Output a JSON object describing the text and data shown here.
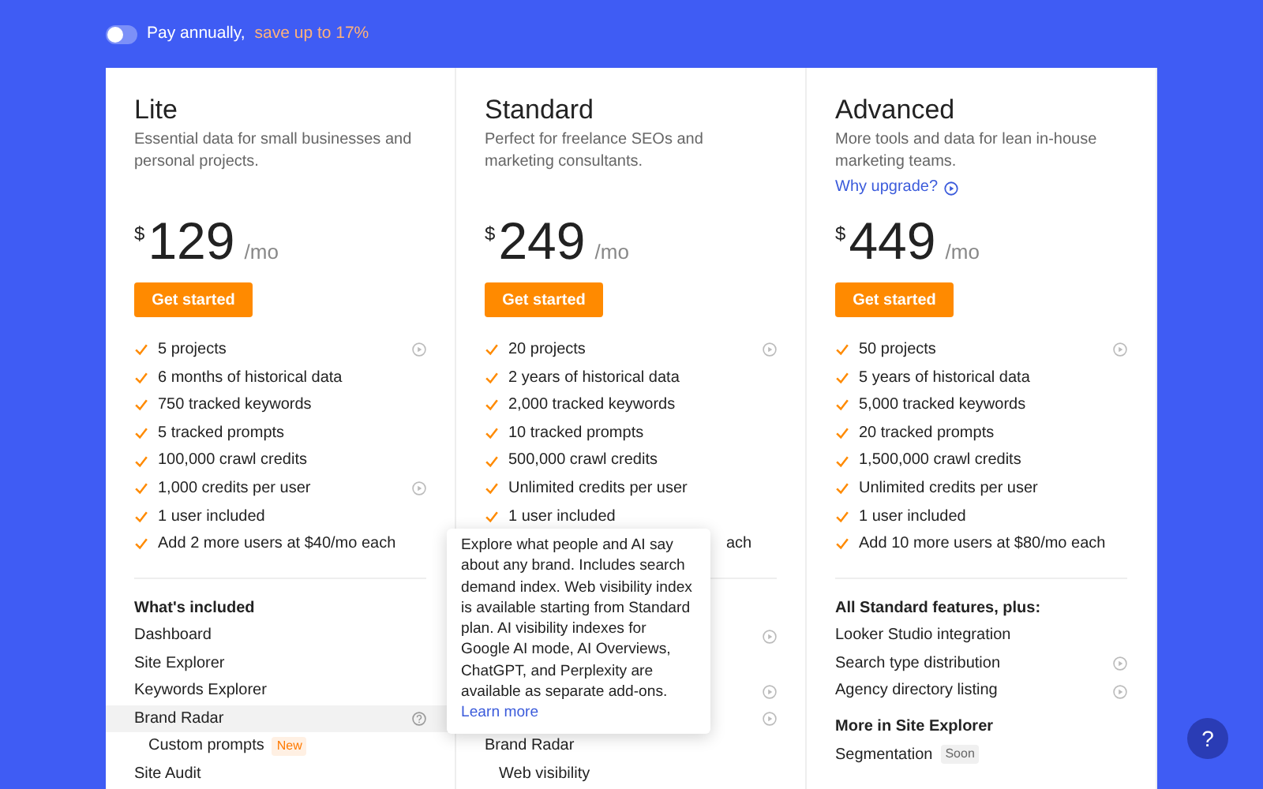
{
  "billing_toggle": {
    "on": false,
    "label": "Pay annually,",
    "highlight": "save up to 17%"
  },
  "plans": [
    {
      "name": "Lite",
      "description": "Essential data for small businesses and personal projects.",
      "currency": "$",
      "price": "129",
      "period": "/mo",
      "button": "Get started",
      "limits": [
        {
          "text": "5 projects",
          "info": true
        },
        {
          "text": "6 months of historical data",
          "info": false
        },
        {
          "text": "750 tracked keywords",
          "info": false
        },
        {
          "text": "5 tracked prompts",
          "info": false
        },
        {
          "text": "100,000 crawl credits",
          "info": false
        },
        {
          "text": "1,000 credits per user",
          "info": true
        },
        {
          "text": "1 user included",
          "info": false
        },
        {
          "text": "Add 2 more users at $40/mo each",
          "info": false
        }
      ],
      "features": [
        {
          "kind": "heading",
          "label": "What's included"
        },
        {
          "kind": "item",
          "label": "Dashboard",
          "info": false,
          "help": false,
          "selected": false
        },
        {
          "kind": "item",
          "label": "Site Explorer",
          "info": false,
          "help": false,
          "selected": false
        },
        {
          "kind": "item",
          "label": "Keywords Explorer",
          "info": false,
          "help": false,
          "selected": false
        },
        {
          "kind": "item",
          "label": "Brand Radar",
          "info": false,
          "help": true,
          "selected": true
        },
        {
          "kind": "subitem",
          "label": "Custom prompts",
          "badge": {
            "text": "New",
            "kind": "new"
          },
          "info": false,
          "help": false,
          "selected": false
        },
        {
          "kind": "item",
          "label": "Site Audit",
          "info": false,
          "help": false,
          "selected": false
        }
      ]
    },
    {
      "name": "Standard",
      "description": "Perfect for freelance SEOs and marketing consultants.",
      "currency": "$",
      "price": "249",
      "period": "/mo",
      "button": "Get started",
      "limits": [
        {
          "text": "20 projects",
          "info": true
        },
        {
          "text": "2 years of historical data",
          "info": false
        },
        {
          "text": "2,000 tracked keywords",
          "info": false
        },
        {
          "text": "10 tracked prompts",
          "info": false
        },
        {
          "text": "500,000 crawl credits",
          "info": false
        },
        {
          "text": "Unlimited credits per user",
          "info": false
        },
        {
          "text": "1 user included",
          "info": false
        },
        {
          "text": "ach",
          "info": false,
          "kind": "covered"
        }
      ],
      "features": [
        {
          "kind": "gap"
        },
        {
          "kind": "item",
          "info": true,
          "help": false,
          "selected": false
        },
        {
          "kind": "item",
          "info": false,
          "help": false,
          "selected": false
        },
        {
          "kind": "item",
          "info": true,
          "help": false,
          "selected": false
        },
        {
          "kind": "item",
          "info": true,
          "help": false,
          "selected": false
        },
        {
          "kind": "item",
          "label": "Brand Radar",
          "info": false,
          "help": false,
          "selected": false
        },
        {
          "kind": "subitem",
          "label": "Web visibility",
          "info": false,
          "help": false,
          "selected": false
        }
      ]
    },
    {
      "name": "Advanced",
      "description": "More tools and data for lean in-house marketing teams.",
      "link": "Why upgrade?",
      "currency": "$",
      "price": "449",
      "period": "/mo",
      "button": "Get started",
      "limits": [
        {
          "text": "50 projects",
          "info": true
        },
        {
          "text": "5 years of historical data",
          "info": false
        },
        {
          "text": "5,000 tracked keywords",
          "info": false
        },
        {
          "text": "20 tracked prompts",
          "info": false
        },
        {
          "text": "1,500,000 crawl credits",
          "info": false
        },
        {
          "text": "Unlimited credits per user",
          "info": false
        },
        {
          "text": "1 user included",
          "info": false
        },
        {
          "text": "Add 10 more users at $80/mo each",
          "info": false
        }
      ],
      "features": [
        {
          "kind": "heading",
          "label": "All Standard features, plus:"
        },
        {
          "kind": "item",
          "label": "Looker Studio integration",
          "info": false,
          "help": false,
          "selected": false
        },
        {
          "kind": "item",
          "label": "Search type distribution",
          "info": true,
          "help": false,
          "selected": false
        },
        {
          "kind": "item",
          "label": "Agency directory listing",
          "info": true,
          "help": false,
          "selected": false
        },
        {
          "kind": "heading",
          "label": "More in Site Explorer"
        },
        {
          "kind": "item",
          "label": "Segmentation",
          "badge": {
            "text": "Soon",
            "kind": "soon"
          },
          "info": false,
          "help": false,
          "selected": false
        }
      ]
    }
  ],
  "tooltip": {
    "text": "Explore what people and AI say about any brand. Includes search demand index. Web visibility index is available starting from Standard plan. AI visibility indexes for Google AI mode, AI Overviews, ChatGPT, and Perplexity are available as separate add-ons.",
    "link": "Learn more"
  },
  "help_button": {
    "label": "?"
  }
}
